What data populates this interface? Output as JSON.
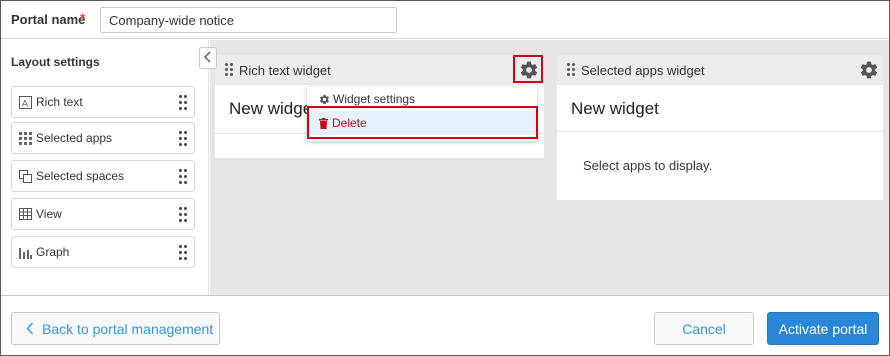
{
  "header": {
    "portal_name_label": "Portal name",
    "required_mark": "*",
    "portal_name_value": "Company-wide notice"
  },
  "sidebar": {
    "title": "Layout settings",
    "items": [
      {
        "label": "Rich text",
        "icon": "rich-text-icon"
      },
      {
        "label": "Selected apps",
        "icon": "apps-grid-icon"
      },
      {
        "label": "Selected spaces",
        "icon": "spaces-icon"
      },
      {
        "label": "View",
        "icon": "table-view-icon"
      },
      {
        "label": "Graph",
        "icon": "graph-icon"
      }
    ]
  },
  "widgets": {
    "rich_text": {
      "header_title": "Rich text widget",
      "body_title": "New widget"
    },
    "selected_apps": {
      "header_title": "Selected apps widget",
      "body_title": "New widget",
      "body_text": "Select apps to display."
    }
  },
  "widget_menu": {
    "settings_label": "Widget settings",
    "delete_label": "Delete"
  },
  "footer": {
    "back_label": "Back to portal management",
    "cancel_label": "Cancel",
    "activate_label": "Activate portal"
  },
  "colors": {
    "accent_blue": "#2a86d6",
    "link_blue": "#3498db",
    "danger_red": "#d0021b",
    "canvas_gray": "#e6e6e6"
  }
}
